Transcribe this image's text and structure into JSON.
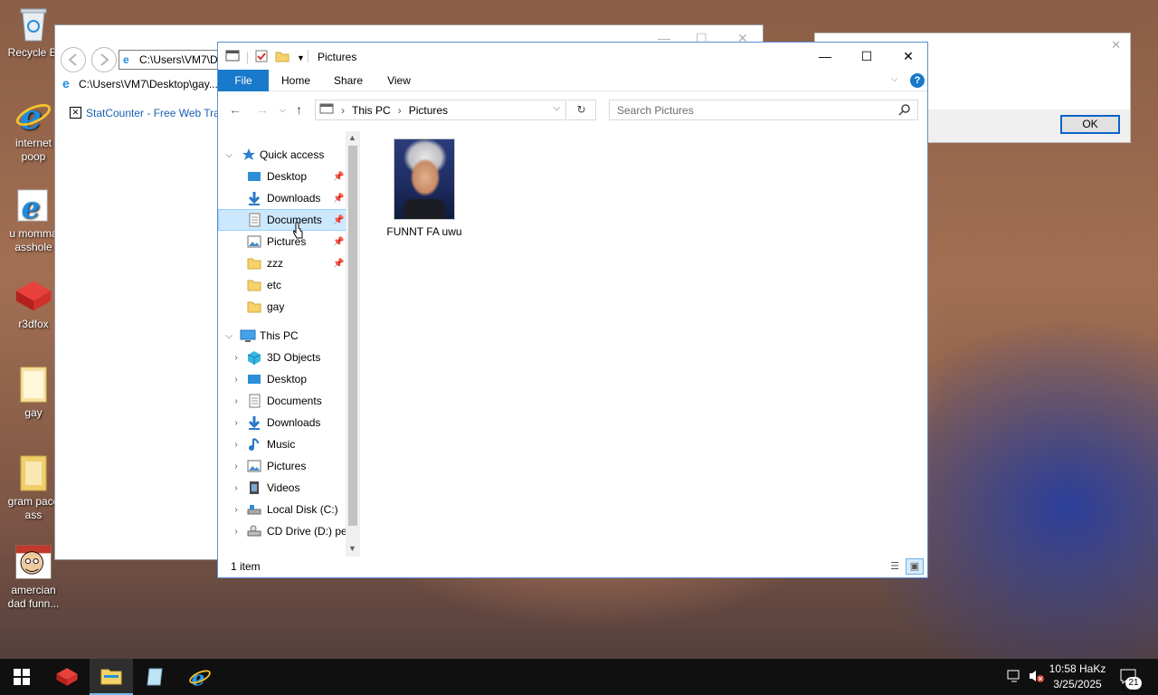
{
  "desktop": {
    "icons": [
      {
        "label": "Recycle Bi",
        "icon": "recycle-bin-icon"
      },
      {
        "label": "internet poop",
        "icon": "internet-explorer-icon"
      },
      {
        "label": "u momma asshole",
        "icon": "internet-explorer-icon"
      },
      {
        "label": "r3dfox",
        "icon": "r3dfox-icon"
      },
      {
        "label": "gay",
        "icon": "folder-icon"
      },
      {
        "label": "gram pace ass",
        "icon": "folder-icon"
      },
      {
        "label": "amercian dad funn...",
        "icon": "cartoon-face-icon"
      }
    ]
  },
  "ie_window": {
    "address": "C:\\Users\\VM7\\D",
    "tab_title": "C:\\Users\\VM7\\Desktop\\gay...",
    "link": "StatCounter - Free Web Track"
  },
  "dialog": {
    "ok_label": "OK"
  },
  "explorer": {
    "title": "Pictures",
    "ribbon_tabs": [
      "File",
      "Home",
      "Share",
      "View"
    ],
    "breadcrumb": [
      "This PC",
      "Pictures"
    ],
    "search_placeholder": "Search Pictures",
    "quick_access_label": "Quick access",
    "quick_access": [
      {
        "label": "Desktop",
        "icon": "desktop-icon",
        "pinned": true
      },
      {
        "label": "Downloads",
        "icon": "downloads-icon",
        "pinned": true
      },
      {
        "label": "Documents",
        "icon": "documents-icon",
        "pinned": true,
        "selected": true
      },
      {
        "label": "Pictures",
        "icon": "pictures-icon",
        "pinned": true
      },
      {
        "label": "zzz",
        "icon": "folder-icon",
        "pinned": true
      },
      {
        "label": "etc",
        "icon": "folder-icon",
        "pinned": false
      },
      {
        "label": "gay",
        "icon": "folder-icon",
        "pinned": false
      }
    ],
    "this_pc_label": "This PC",
    "this_pc": [
      {
        "label": "3D Objects",
        "icon": "3d-objects-icon"
      },
      {
        "label": "Desktop",
        "icon": "desktop-icon"
      },
      {
        "label": "Documents",
        "icon": "documents-icon"
      },
      {
        "label": "Downloads",
        "icon": "downloads-icon"
      },
      {
        "label": "Music",
        "icon": "music-icon"
      },
      {
        "label": "Pictures",
        "icon": "pictures-icon"
      },
      {
        "label": "Videos",
        "icon": "videos-icon"
      },
      {
        "label": "Local Disk (C:)",
        "icon": "local-disk-icon"
      },
      {
        "label": "CD Drive (D:) pe",
        "icon": "cd-drive-icon"
      }
    ],
    "files": [
      {
        "name": "FUNNT FA uwu",
        "icon": "image-thumbnail"
      }
    ],
    "status": "1 item"
  },
  "taskbar": {
    "clock_time": "10:58 HaKz",
    "clock_date": "3/25/2025",
    "notification_count": "21"
  },
  "colors": {
    "accent": "#1979ca",
    "selection": "#cce8ff",
    "taskbar": "#101010"
  }
}
